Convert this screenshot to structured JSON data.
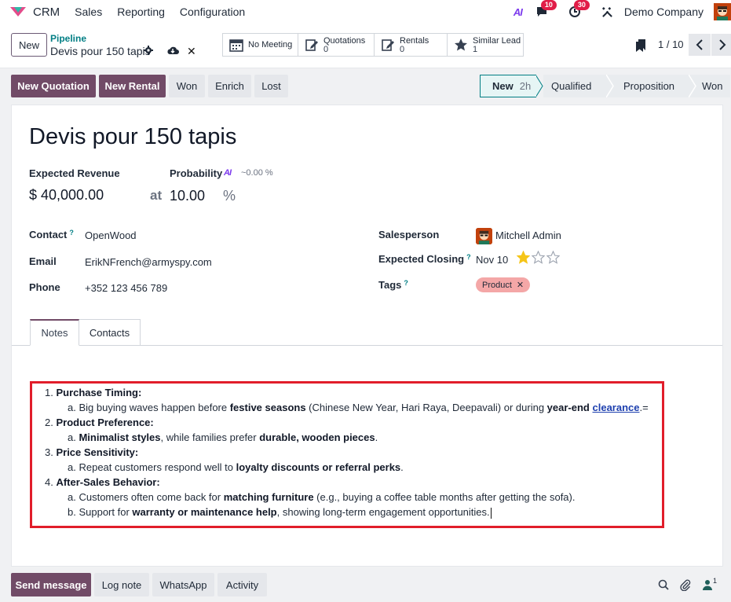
{
  "topnav": {
    "app_name": "CRM",
    "menu": [
      "Sales",
      "Reporting",
      "Configuration"
    ],
    "ai_label": "AI",
    "messages_count": "10",
    "activities_count": "30",
    "company": "Demo Company"
  },
  "control": {
    "new_label": "New",
    "breadcrumb_parent": "Pipeline",
    "breadcrumb_current": "Devis pour 150 tapis",
    "smart_buttons": [
      {
        "label": "No Meeting",
        "value": ""
      },
      {
        "label": "Quotations",
        "value": "0"
      },
      {
        "label": "Rentals",
        "value": "0"
      },
      {
        "label": "Similar Lead",
        "value": "1"
      }
    ],
    "pager": "1 / 10"
  },
  "actions": {
    "new_quotation": "New Quotation",
    "new_rental": "New Rental",
    "won": "Won",
    "enrich": "Enrich",
    "lost": "Lost"
  },
  "stages": [
    {
      "label": "New",
      "duration": "2h",
      "current": true
    },
    {
      "label": "Qualified",
      "duration": "",
      "current": false
    },
    {
      "label": "Proposition",
      "duration": "",
      "current": false
    },
    {
      "label": "Won",
      "duration": "",
      "current": false
    }
  ],
  "form": {
    "title": "Devis pour 150 tapis",
    "expected_revenue_label": "Expected Revenue",
    "expected_revenue": "$ 40,000.00",
    "at_label": "at",
    "probability_label": "Probability",
    "ai_label": "AI",
    "ai_probability": "~0.00 %",
    "probability": "10.00",
    "percent_sign": "%",
    "contact_label": "Contact",
    "contact": "OpenWood",
    "email_label": "Email",
    "email": "ErikNFrench@armyspy.com",
    "phone_label": "Phone",
    "phone": "+352 123 456 789",
    "salesperson_label": "Salesperson",
    "salesperson": "Mitchell Admin",
    "expected_closing_label": "Expected Closing",
    "expected_closing": "Nov 10",
    "priority_stars": 1,
    "priority_max": 3,
    "tags_label": "Tags",
    "tag": "Product",
    "help_mark": "?"
  },
  "tabs": [
    "Notes",
    "Contacts"
  ],
  "notes": {
    "items": [
      {
        "number": "1.",
        "heading": "Purchase Timing:",
        "subs": [
          {
            "letter": "a.",
            "t1": "Big buying waves happen before ",
            "b1": "festive seasons",
            "t2": " (Chinese New Year, Hari Raya, Deepavali) or during ",
            "b2": "year-end",
            "t3": " ",
            "link": "clearance",
            "t4": ".="
          }
        ]
      },
      {
        "number": "2.",
        "heading": "Product Preference:",
        "subs": [
          {
            "letter": "a.",
            "b1": "Minimalist styles",
            "t2": ", while families prefer ",
            "b2": "durable, wooden pieces",
            "t3": "."
          }
        ]
      },
      {
        "number": "3.",
        "heading": "Price Sensitivity:",
        "subs": [
          {
            "letter": "a.",
            "t1": "Repeat customers respond well to ",
            "b1": "loyalty discounts or referral perks",
            "t2": "."
          }
        ]
      },
      {
        "number": "4.",
        "heading": "After-Sales Behavior:",
        "subs": [
          {
            "letter": "a.",
            "t1": "Customers often come back for ",
            "b1": "matching furniture",
            "t2": " (e.g., buying a coffee table months after getting the sofa)."
          },
          {
            "letter": "b.",
            "t1": "Support for ",
            "b1": "warranty or maintenance help",
            "t2": ", showing long-term engagement opportunities."
          }
        ]
      }
    ]
  },
  "chatter": {
    "send_message": "Send message",
    "log_note": "Log note",
    "whatsapp": "WhatsApp",
    "activity": "Activity",
    "followers_count": "1"
  },
  "colors": {
    "brand": "#714b67",
    "link": "#017e84",
    "badge": "#e11d48",
    "highlight_border": "#e11d2a",
    "tag_bg": "#f4a7a7",
    "star": "#f5c518"
  }
}
